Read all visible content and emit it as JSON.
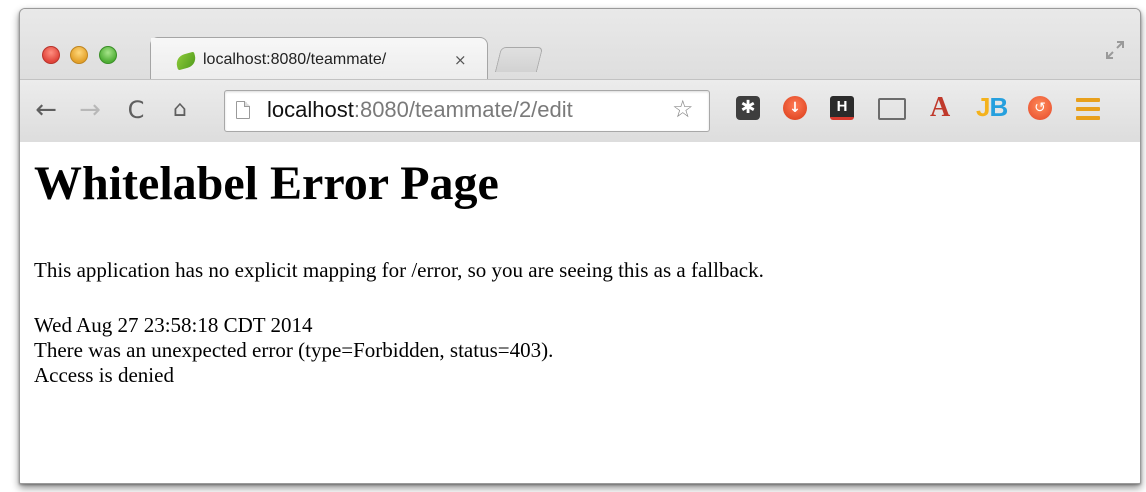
{
  "tab": {
    "title": "localhost:8080/teammate/",
    "close_glyph": "×"
  },
  "toolbar": {
    "back_icon": "arrow-left-icon",
    "forward_icon": "arrow-right-icon",
    "reload_icon": "reload-icon",
    "home_icon": "home-icon"
  },
  "omnibox": {
    "url_host": "localhost",
    "url_rest": ":8080/teammate/2/edit"
  },
  "extensions": {
    "a_label": "A",
    "jb_j": "J",
    "jb_b": "B",
    "h_label": "H"
  },
  "page": {
    "heading": "Whitelabel Error Page",
    "message": "This application has no explicit mapping for /error, so you are seeing this as a fallback.",
    "timestamp": "Wed Aug 27 23:58:18 CDT 2014",
    "error_line": "There was an unexpected error (type=Forbidden, status=403).",
    "detail": "Access is denied"
  },
  "colors": {
    "traffic_close": "#e0443a",
    "traffic_minimize": "#e3a12a",
    "traffic_maximize": "#4fae35",
    "menu_accent": "#e8a01c"
  }
}
